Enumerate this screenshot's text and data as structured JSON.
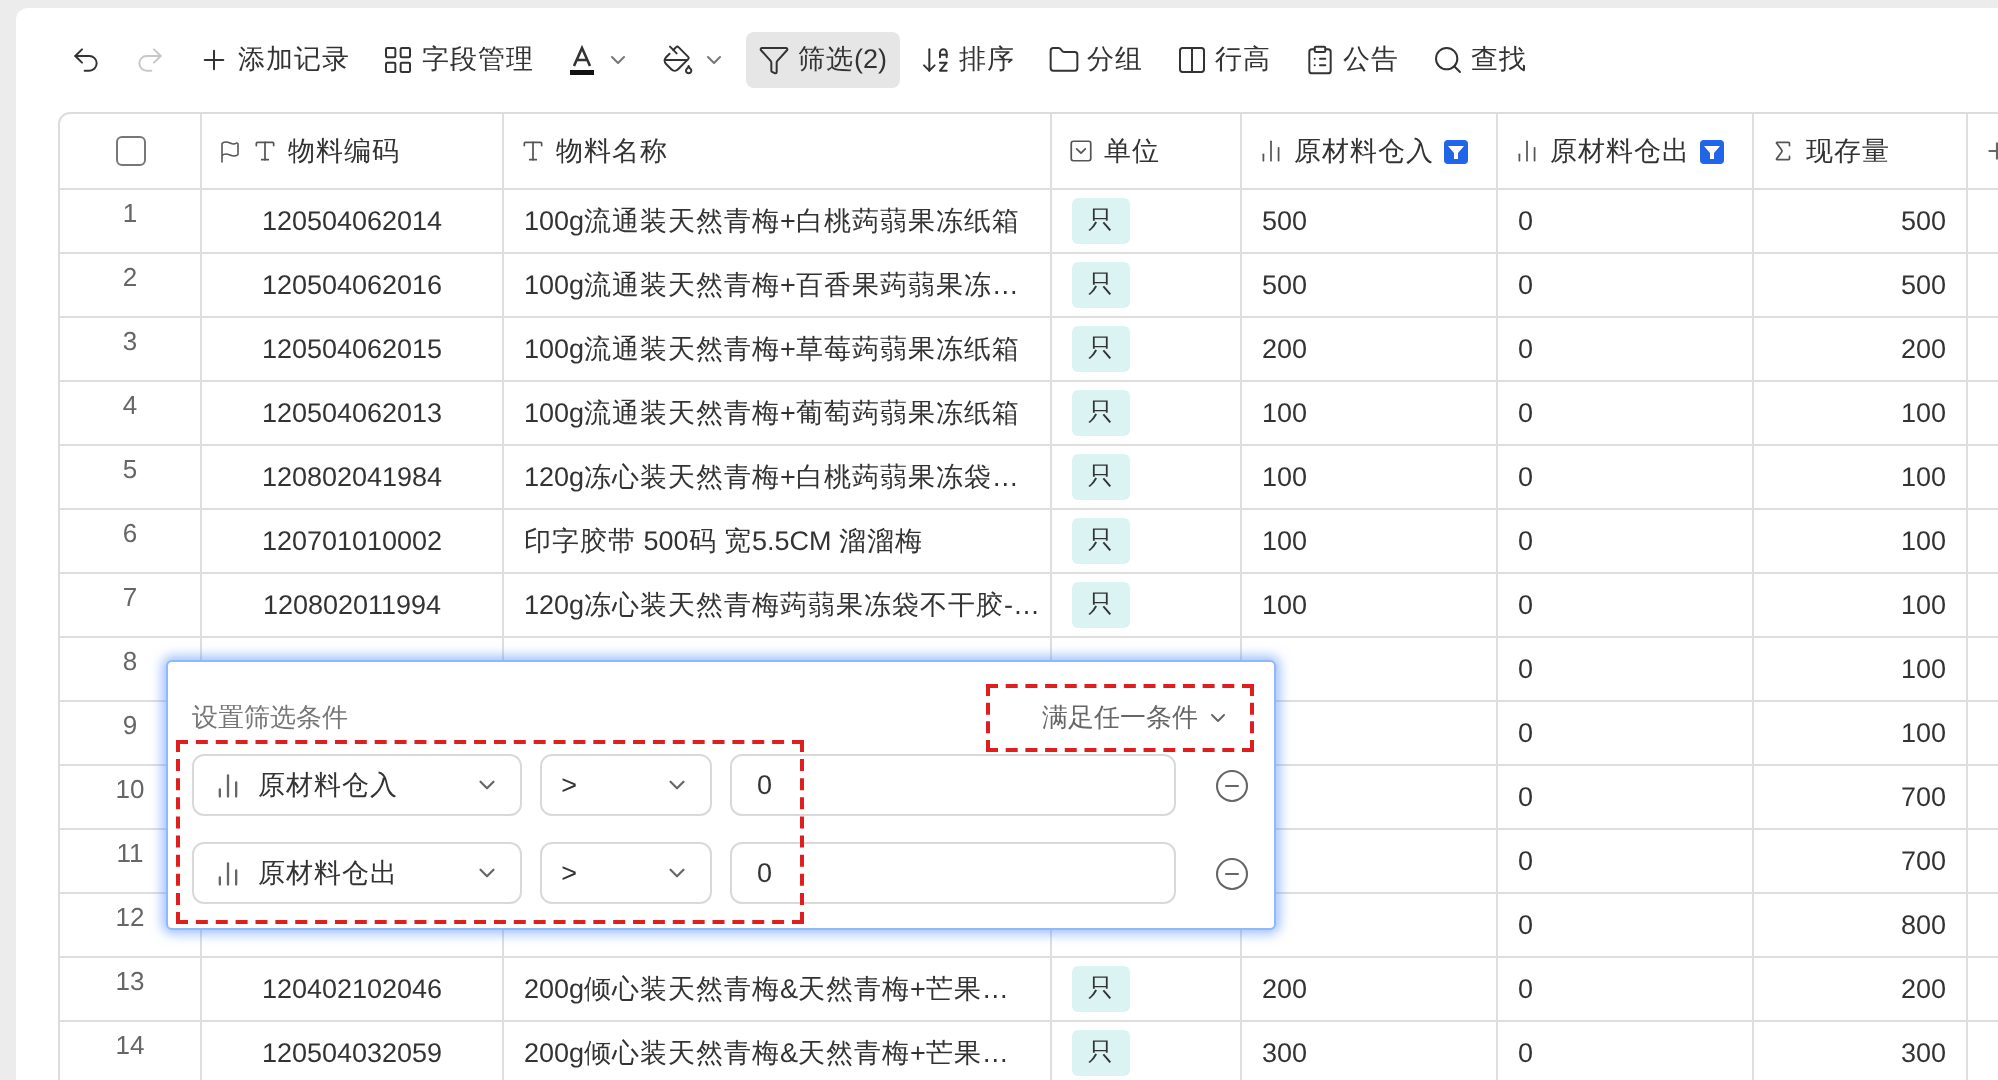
{
  "toolbar": [
    {
      "kind": "undo",
      "disabled": false
    },
    {
      "kind": "redo",
      "disabled": true
    },
    {
      "kind": "add",
      "label": "添加记录"
    },
    {
      "kind": "fields",
      "label": "字段管理"
    },
    {
      "kind": "text-color"
    },
    {
      "kind": "fill-color"
    },
    {
      "kind": "filter",
      "label": "筛选(2)",
      "selected": true
    },
    {
      "kind": "sort",
      "label": "排序",
      "selected": false
    },
    {
      "kind": "group",
      "label": "分组",
      "selected": false
    },
    {
      "kind": "row-height",
      "label": "行高"
    },
    {
      "kind": "notice",
      "label": "公告"
    },
    {
      "kind": "search",
      "label": "查找"
    }
  ],
  "table": {
    "select_all": {
      "checked": false
    },
    "columns": [
      {
        "label": "物料编码",
        "kind": "text",
        "primary": true,
        "filtered": false
      },
      {
        "label": "物料名称",
        "kind": "text",
        "primary": false,
        "filtered": false
      },
      {
        "label": "单位",
        "kind": "select",
        "primary": false,
        "filtered": false
      },
      {
        "label": "原材料仓入",
        "kind": "number",
        "primary": false,
        "filtered": true
      },
      {
        "label": "原材料仓出",
        "kind": "number",
        "primary": false,
        "filtered": true
      },
      {
        "label": "现存量",
        "kind": "formula",
        "primary": false,
        "filtered": false
      }
    ],
    "rows": [
      {
        "index": "1",
        "code": "120504062014",
        "name": "100g流通装天然青梅+白桃蒟蒻果冻纸箱",
        "unit": "只",
        "in": "500",
        "out": "0",
        "stock": "500"
      },
      {
        "index": "2",
        "code": "120504062016",
        "name": "100g流通装天然青梅+百香果蒟蒻果冻…",
        "unit": "只",
        "in": "500",
        "out": "0",
        "stock": "500"
      },
      {
        "index": "3",
        "code": "120504062015",
        "name": "100g流通装天然青梅+草莓蒟蒻果冻纸箱",
        "unit": "只",
        "in": "200",
        "out": "0",
        "stock": "200"
      },
      {
        "index": "4",
        "code": "120504062013",
        "name": "100g流通装天然青梅+葡萄蒟蒻果冻纸箱",
        "unit": "只",
        "in": "100",
        "out": "0",
        "stock": "100"
      },
      {
        "index": "5",
        "code": "120802041984",
        "name": "120g冻心装天然青梅+白桃蒟蒻果冻袋…",
        "unit": "只",
        "in": "100",
        "out": "0",
        "stock": "100"
      },
      {
        "index": "6",
        "code": "120701010002",
        "name": "印字胶带 500码 宽5.5CM 溜溜梅",
        "unit": "只",
        "in": "100",
        "out": "0",
        "stock": "100"
      },
      {
        "index": "7",
        "code": "120802011994",
        "name": "120g冻心装天然青梅蒟蒻果冻袋不干胶-…",
        "unit": "只",
        "in": "100",
        "out": "0",
        "stock": "100"
      },
      {
        "index": "8",
        "out": "0",
        "stock": "100"
      },
      {
        "index": "9",
        "out": "0",
        "stock": "100"
      },
      {
        "index": "10",
        "out": "0",
        "stock": "700"
      },
      {
        "index": "11",
        "out": "0",
        "stock": "700"
      },
      {
        "index": "12",
        "out": "0",
        "stock": "800"
      },
      {
        "index": "13",
        "code": "120402102046",
        "name": "200g倾心装天然青梅&天然青梅+芒果…",
        "unit": "只",
        "in": "200",
        "out": "0",
        "stock": "200"
      },
      {
        "index": "14",
        "code": "120504032059",
        "name": "200g倾心装天然青梅&天然青梅+芒果…",
        "unit": "只",
        "in": "300",
        "out": "0",
        "stock": "300"
      }
    ]
  },
  "filter_panel": {
    "title": "设置筛选条件",
    "match": "满足任一条件",
    "conditions": [
      {
        "kind": "number",
        "field": "原材料仓入",
        "operator": ">",
        "value": "0"
      },
      {
        "kind": "number",
        "field": "原材料仓出",
        "operator": ">",
        "value": "0"
      }
    ]
  }
}
